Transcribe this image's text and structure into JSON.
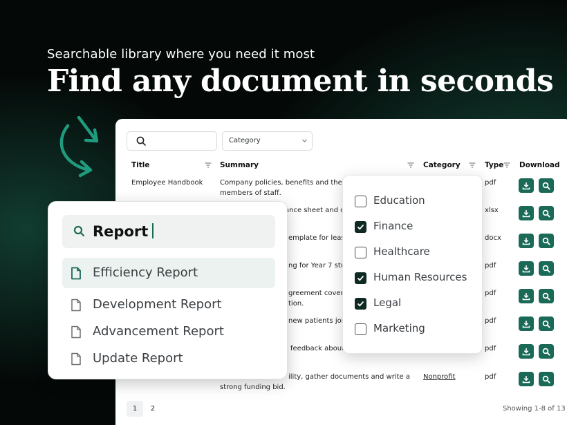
{
  "hero": {
    "subtitle": "Searchable library where you need it most",
    "title": "Find any document in seconds"
  },
  "table": {
    "search_placeholder": "",
    "category_select": "Category",
    "headers": [
      "Title",
      "Summary",
      "Category",
      "Type",
      "Download"
    ],
    "rows": [
      {
        "title": "Employee Handbook",
        "summary_line1": "Company policies, benefits and the co",
        "summary_line2": "members of staff.",
        "category": "",
        "type": "pdf"
      },
      {
        "title": "",
        "summary_line1": "ance sheet and c",
        "summary_line2": "",
        "category": "",
        "type": "xlsx"
      },
      {
        "title": "",
        "summary_line1": "emplate for leasi",
        "summary_line2": "",
        "category": "",
        "type": "docx"
      },
      {
        "title": "",
        "summary_line1": "ng for Year 7 stu",
        "summary_line2": "",
        "category": "",
        "type": "pdf"
      },
      {
        "title": "",
        "summary_line1": "greement coverin",
        "summary_line2": "tion.",
        "category": "",
        "type": "pdf"
      },
      {
        "title": "",
        "summary_line1": "new patients join",
        "summary_line2": "",
        "category": "",
        "type": "pdf"
      },
      {
        "title": "",
        "summary_line1": "feedback about",
        "summary_line2": "",
        "category": "",
        "type": "pdf"
      },
      {
        "title": "",
        "summary_line1": "ility, gather documents and write a",
        "summary_line2": "strong funding bid.",
        "category": "Nonprofit",
        "type": "pdf"
      }
    ],
    "pages": [
      "1",
      "2"
    ],
    "showing": "Showing 1-8 of 13"
  },
  "search_popup": {
    "query": "Report",
    "results": [
      "Efficiency Report",
      "Development Report",
      "Advancement Report",
      "Update Report"
    ],
    "active_index": 0
  },
  "category_dropdown": {
    "options": [
      {
        "label": "Education",
        "checked": false
      },
      {
        "label": "Finance",
        "checked": true
      },
      {
        "label": "Healthcare",
        "checked": false
      },
      {
        "label": "Human Resources",
        "checked": true
      },
      {
        "label": "Legal",
        "checked": true
      },
      {
        "label": "Marketing",
        "checked": false
      }
    ]
  },
  "colors": {
    "accent": "#1b6a58",
    "checkbox_checked": "#0f2a23",
    "background": "#040807"
  },
  "icons": {
    "search": "search-icon",
    "download": "download-icon",
    "preview": "magnifier-icon",
    "file": "file-icon",
    "filter": "filter-icon",
    "arrow": "curved-arrow-icon"
  }
}
